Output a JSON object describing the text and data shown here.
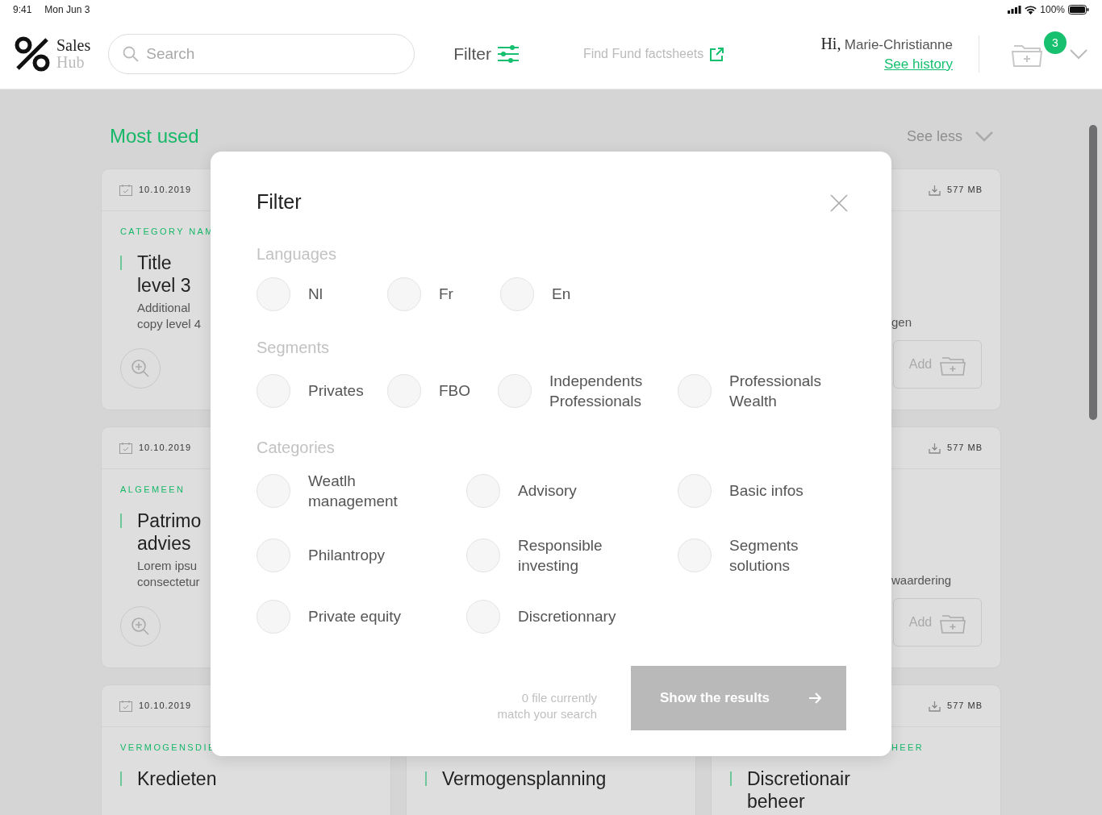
{
  "status_bar": {
    "time": "9:41",
    "date": "Mon Jun 3",
    "battery": "100%"
  },
  "header": {
    "logo": {
      "line_1": "Sales",
      "line_2": "Hub"
    },
    "search": {
      "placeholder": "Search"
    },
    "filter_label": "Filter",
    "factsheets_link": "Find Fund factsheets",
    "greeting": {
      "hi": "Hi,",
      "name": "Marie-Christianne"
    },
    "history_link": "See history",
    "cart_badge": "3"
  },
  "section": {
    "title": "Most used",
    "toggle": "See less"
  },
  "rows": [
    {
      "left": {
        "date": "10.10.2019",
        "category": "CATEGORY NAM",
        "title": [
          "Title",
          "level 3"
        ],
        "subtitle": [
          "Additional",
          "copy level 4"
        ],
        "button": {
          "kind": "zoom"
        }
      },
      "right": {
        "size": "577 MB",
        "subtitle": [
          "gen"
        ],
        "button": {
          "kind": "add",
          "label": "Add"
        }
      }
    },
    {
      "left": {
        "date": "10.10.2019",
        "category": "ALGEMEEN",
        "title": [
          "Patrimo",
          "advies"
        ],
        "subtitle": [
          "Lorem ipsu",
          "consectetur"
        ],
        "button": {
          "kind": "zoom"
        }
      },
      "right": {
        "size": "577 MB",
        "subtitle": [
          "waardering"
        ],
        "button": {
          "kind": "add",
          "label": "Add"
        }
      }
    },
    {
      "left": {
        "date": "10.10.2019",
        "category": "VERMOGENSDIE",
        "title": [
          "Kredieten"
        ]
      },
      "middle": {
        "title": [
          "Vermogensplanning"
        ]
      },
      "right": {
        "size": "577 MB",
        "category": "HEER",
        "title": [
          "Discretionair",
          "beheer"
        ]
      }
    }
  ],
  "dialog": {
    "title": "Filter",
    "groups": [
      {
        "label": "Languages",
        "kind": "languages",
        "options": [
          {
            "label": "Nl",
            "selected": false
          },
          {
            "label": "Fr",
            "selected": false
          },
          {
            "label": "En",
            "selected": false
          }
        ]
      },
      {
        "label": "Segments",
        "kind": "segments",
        "options": [
          {
            "label": "Privates",
            "selected": false
          },
          {
            "label": "FBO",
            "selected": false
          },
          {
            "label": "Independents Professionals",
            "selected": false
          },
          {
            "label": "Professionals Wealth",
            "selected": false
          }
        ]
      },
      {
        "label": "Categories",
        "kind": "categories",
        "options": [
          {
            "label": "Weatlh management",
            "selected": false
          },
          {
            "label": "Advisory",
            "selected": false
          },
          {
            "label": "Basic infos",
            "selected": false
          },
          {
            "label": "Philantropy",
            "selected": false
          },
          {
            "label": "Responsible investing",
            "selected": false
          },
          {
            "label": "Segments solutions",
            "selected": false
          },
          {
            "label": "Private equity",
            "selected": false
          },
          {
            "label": "Discretionnary",
            "selected": false
          }
        ]
      }
    ],
    "result_note": [
      "0 file currently",
      "match your search"
    ],
    "submit": {
      "label": "Show the results",
      "disabled": true
    }
  }
}
